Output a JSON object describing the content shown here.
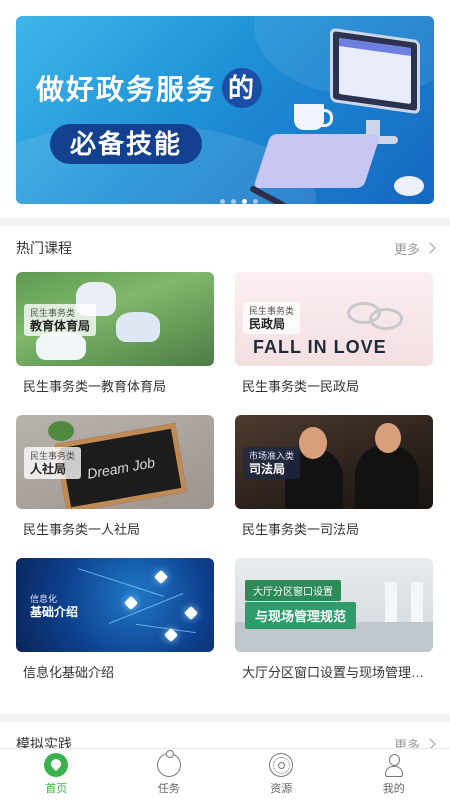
{
  "banner": {
    "title": "做好政务服务",
    "title_accent": "的",
    "subtitle": "必备技能",
    "page_count": 4,
    "active_index": 2
  },
  "hot_courses": {
    "title": "热门课程",
    "more_label": "更多",
    "items": [
      {
        "caption": "民生事务类一教育体育局",
        "tag_small": "民生事务类",
        "tag_big": "教育体育局"
      },
      {
        "caption": "民生事务类一民政局",
        "tag_small": "民生事务类",
        "tag_big": "民政局",
        "image_text": "FALL IN LOVE"
      },
      {
        "caption": "民生事务类一人社局",
        "tag_small": "民生事务类",
        "tag_big": "人社局",
        "image_text": "Dream Job"
      },
      {
        "caption": "民生事务类一司法局",
        "tag_small": "市场准入类",
        "tag_big": "司法局"
      },
      {
        "caption": "信息化基础介绍",
        "tag_small": "信息化",
        "tag_big": "基础介绍"
      },
      {
        "caption": "大厅分区窗口设置与现场管理规范",
        "tag_small": "大厅分区窗口设置",
        "tag_big": "与现场管理规范"
      }
    ]
  },
  "simulation": {
    "title": "模拟实践",
    "more_label": "更多"
  },
  "tabbar": {
    "items": [
      {
        "label": "首页",
        "icon": "home-icon",
        "active": true
      },
      {
        "label": "任务",
        "icon": "task-icon",
        "active": false
      },
      {
        "label": "资源",
        "icon": "resource-icon",
        "active": false
      },
      {
        "label": "我的",
        "icon": "profile-icon",
        "active": false
      }
    ]
  },
  "colors": {
    "accent": "#3bb24f",
    "banner_start": "#3fb6e8",
    "banner_end": "#1567c0"
  }
}
